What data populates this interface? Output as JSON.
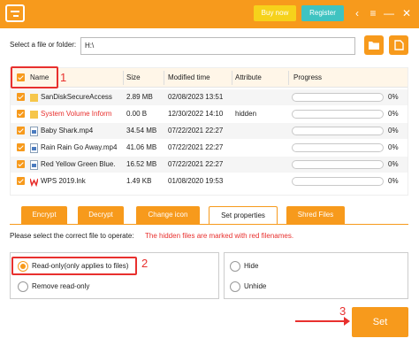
{
  "titlebar": {
    "buy_label": "Buy now",
    "register_label": "Register",
    "icons": [
      "share-icon",
      "menu-icon",
      "minimize-icon",
      "close-icon"
    ]
  },
  "path": {
    "label": "Select a file or folder:",
    "value": "H:\\"
  },
  "table": {
    "headers": [
      "Name",
      "Size",
      "Modified time",
      "Attribute",
      "Progress"
    ],
    "rows": [
      {
        "name": "SanDiskSecureAccess",
        "size": "2.89 MB",
        "modified": "02/08/2023 13:51",
        "attribute": "",
        "progress": "0%",
        "icon": "folder-icon",
        "hidden": false
      },
      {
        "name": "System Volume Inform",
        "size": "0.00 B",
        "modified": "12/30/2022 14:10",
        "attribute": "hidden",
        "progress": "0%",
        "icon": "folder-icon",
        "hidden": true
      },
      {
        "name": "Baby Shark.mp4",
        "size": "34.54 MB",
        "modified": "07/22/2021 22:27",
        "attribute": "",
        "progress": "0%",
        "icon": "video-file-icon",
        "hidden": false
      },
      {
        "name": "Rain Rain Go Away.mp4",
        "size": "41.06 MB",
        "modified": "07/22/2021 22:27",
        "attribute": "",
        "progress": "0%",
        "icon": "video-file-icon",
        "hidden": false
      },
      {
        "name": "Red Yellow Green Blue.",
        "size": "16.52 MB",
        "modified": "07/22/2021 22:27",
        "attribute": "",
        "progress": "0%",
        "icon": "video-file-icon",
        "hidden": false
      },
      {
        "name": "WPS 2019.lnk",
        "size": "1.49 KB",
        "modified": "01/08/2020 19:53",
        "attribute": "",
        "progress": "0%",
        "icon": "wps-icon",
        "hidden": false
      }
    ]
  },
  "tabs": [
    "Encrypt",
    "Decrypt",
    "Change icon",
    "Set properties",
    "Shred Files"
  ],
  "active_tab": "Set properties",
  "hint": "Please select the correct file to operate:",
  "hint_red": "The hidden files are marked with red filenames.",
  "options_left": [
    "Read-only(only applies to files)",
    "Remove read-only"
  ],
  "options_right": [
    "Hide",
    "Unhide"
  ],
  "set_label": "Set",
  "annotations": [
    "1",
    "2",
    "3"
  ],
  "colors": {
    "accent": "#f79a1c",
    "annotation": "#e8302e",
    "buy": "#f6d21b",
    "register": "#3fc3c1"
  }
}
